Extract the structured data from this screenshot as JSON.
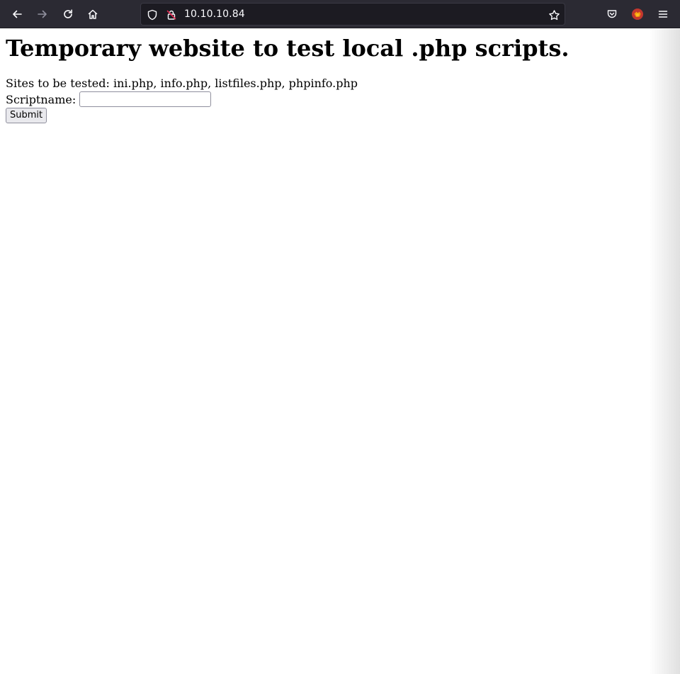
{
  "browser": {
    "url": "10.10.10.84",
    "icons": {
      "back": "back-arrow-icon",
      "forward": "forward-arrow-icon",
      "reload": "reload-icon",
      "home": "home-icon",
      "tracking": "shield-icon",
      "lock": "insecure-lock-icon",
      "bookmark": "star-icon",
      "pocket": "pocket-icon",
      "extension": "extension-icon",
      "menu": "hamburger-menu-icon"
    },
    "colors": {
      "toolbar": "#2b2a33",
      "urlbar": "#1c1b22",
      "icon": "#fbfbfe",
      "lock_warning": "#e22850"
    }
  },
  "page": {
    "title": "Temporary website to test local .php scripts.",
    "sites_text": "Sites to be tested: ini.php, info.php, listfiles.php, phpinfo.php",
    "form": {
      "label": "Scriptname:",
      "input_value": "",
      "submit_label": "Submit"
    }
  }
}
